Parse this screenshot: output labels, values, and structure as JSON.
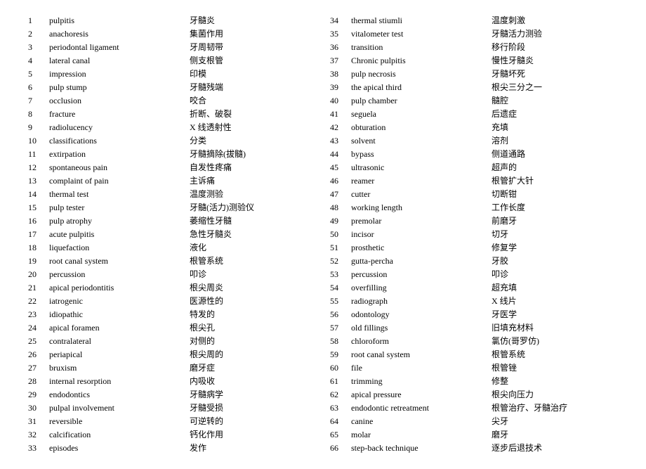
{
  "left": [
    {
      "n": "1",
      "en": "pulpitis",
      "zh": "牙髓炎"
    },
    {
      "n": "2",
      "en": "anachoresis",
      "zh": "集菌作用"
    },
    {
      "n": "3",
      "en": "periodontal ligament",
      "zh": "牙周韧带"
    },
    {
      "n": "4",
      "en": "lateral canal",
      "zh": "侧支根管"
    },
    {
      "n": "5",
      "en": "impression",
      "zh": "印模"
    },
    {
      "n": "6",
      "en": "pulp stump",
      "zh": "牙髓残端"
    },
    {
      "n": "7",
      "en": "occlusion",
      "zh": "咬合"
    },
    {
      "n": "8",
      "en": "fracture",
      "zh": "折断、破裂"
    },
    {
      "n": "9",
      "en": "radiolucency",
      "zh": "X 线透射性"
    },
    {
      "n": "10",
      "en": "classifications",
      "zh": "分类"
    },
    {
      "n": "11",
      "en": "extirpation",
      "zh": "牙髓摘除(拔髓)"
    },
    {
      "n": "12",
      "en": "spontaneous pain",
      "zh": "自发性疼痛"
    },
    {
      "n": "13",
      "en": "complaint of pain",
      "zh": "主诉痛"
    },
    {
      "n": "14",
      "en": "thermal test",
      "zh": "温度测验"
    },
    {
      "n": "15",
      "en": "pulp tester",
      "zh": "牙髓(活力)测验仪"
    },
    {
      "n": "16",
      "en": "pulp atrophy",
      "zh": "萎缩性牙髓"
    },
    {
      "n": "17",
      "en": "acute pulpitis",
      "zh": "急性牙髓炎"
    },
    {
      "n": "18",
      "en": "liquefaction",
      "zh": "液化"
    },
    {
      "n": "19",
      "en": "root canal system",
      "zh": "根管系统"
    },
    {
      "n": "20",
      "en": "percussion",
      "zh": "叩诊"
    },
    {
      "n": "21",
      "en": "apical periodontitis",
      "zh": "根尖周炎"
    },
    {
      "n": "22",
      "en": "iatrogenic",
      "zh": "医源性的"
    },
    {
      "n": "23",
      "en": "idiopathic",
      "zh": "特发的"
    },
    {
      "n": "24",
      "en": "apical foramen",
      "zh": "根尖孔"
    },
    {
      "n": "25",
      "en": "contralateral",
      "zh": "对侧的"
    },
    {
      "n": "26",
      "en": "periapical",
      "zh": "根尖周的"
    },
    {
      "n": "27",
      "en": "bruxism",
      "zh": "磨牙症"
    },
    {
      "n": "28",
      "en": "internal resorption",
      "zh": "内吸收"
    },
    {
      "n": "29",
      "en": "endodontics",
      "zh": "牙髓病学"
    },
    {
      "n": "30",
      "en": "pulpal involvement",
      "zh": "牙髓受损"
    },
    {
      "n": "31",
      "en": "reversible",
      "zh": "可逆转的"
    },
    {
      "n": "32",
      "en": "calcification",
      "zh": "钙化作用"
    },
    {
      "n": "33",
      "en": "episodes",
      "zh": "发作"
    }
  ],
  "right": [
    {
      "n": "34",
      "en": "thermal stiumli",
      "zh": "温度刺激"
    },
    {
      "n": "35",
      "en": "vitalometer test",
      "zh": "牙髓活力测验"
    },
    {
      "n": "36",
      "en": "transition",
      "zh": "移行阶段"
    },
    {
      "n": "37",
      "en": "Chronic pulpitis",
      "zh": "慢性牙髓炎"
    },
    {
      "n": "38",
      "en": "pulp necrosis",
      "zh": "牙髓坏死"
    },
    {
      "n": "39",
      "en": "the apical third",
      "zh": "根尖三分之一"
    },
    {
      "n": "40",
      "en": "pulp chamber",
      "zh": "髓腔"
    },
    {
      "n": "41",
      "en": "seguela",
      "zh": "后遗症"
    },
    {
      "n": "42",
      "en": "obturation",
      "zh": "充填"
    },
    {
      "n": "43",
      "en": "solvent",
      "zh": "溶剂"
    },
    {
      "n": "44",
      "en": "bypass",
      "zh": "侧道通路"
    },
    {
      "n": "45",
      "en": "ultrasonic",
      "zh": "超声的"
    },
    {
      "n": "46",
      "en": "reamer",
      "zh": "根管扩大针"
    },
    {
      "n": "47",
      "en": "cutter",
      "zh": "切断钳"
    },
    {
      "n": "48",
      "en": "working length",
      "zh": "工作长度"
    },
    {
      "n": "49",
      "en": "premolar",
      "zh": "前磨牙"
    },
    {
      "n": "50",
      "en": "incisor",
      "zh": "切牙"
    },
    {
      "n": "51",
      "en": "prosthetic",
      "zh": "修复学"
    },
    {
      "n": "52",
      "en": "gutta-percha",
      "zh": "牙胶"
    },
    {
      "n": "53",
      "en": "percussion",
      "zh": "叩诊"
    },
    {
      "n": "54",
      "en": "overfilling",
      "zh": "超充填"
    },
    {
      "n": "55",
      "en": "radiograph",
      "zh": "X 线片"
    },
    {
      "n": "56",
      "en": "odontology",
      "zh": "牙医学"
    },
    {
      "n": "57",
      "en": "old fillings",
      "zh": "旧填充材料"
    },
    {
      "n": "58",
      "en": "chloroform",
      "zh": "氯仿(哥罗仿)"
    },
    {
      "n": "59",
      "en": "root canal system",
      "zh": "根管系统"
    },
    {
      "n": "60",
      "en": "file",
      "zh": "根管锉"
    },
    {
      "n": "61",
      "en": "trimming",
      "zh": "修整"
    },
    {
      "n": "62",
      "en": "apical pressure",
      "zh": "根尖向压力"
    },
    {
      "n": "63",
      "en": "endodontic retreatment",
      "zh": "根管治疗、牙髓治疗"
    },
    {
      "n": "64",
      "en": "canine",
      "zh": "尖牙"
    },
    {
      "n": "65",
      "en": "molar",
      "zh": "磨牙"
    },
    {
      "n": "66",
      "en": "step-back technique",
      "zh": "逐步后退技术"
    }
  ]
}
